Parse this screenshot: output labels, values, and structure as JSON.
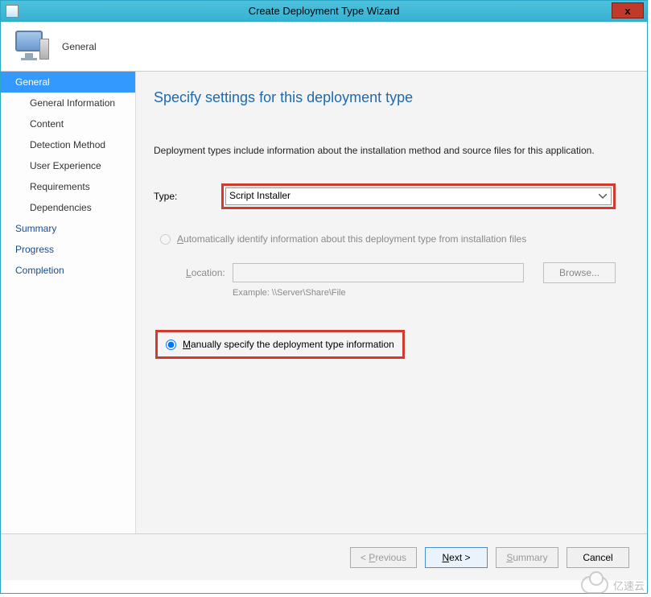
{
  "window": {
    "title": "Create Deployment Type Wizard",
    "close": "x"
  },
  "header": {
    "section": "General"
  },
  "sidebar": {
    "items": [
      {
        "label": "General",
        "active": true,
        "sub": false
      },
      {
        "label": "General Information",
        "active": false,
        "sub": true
      },
      {
        "label": "Content",
        "active": false,
        "sub": true
      },
      {
        "label": "Detection Method",
        "active": false,
        "sub": true
      },
      {
        "label": "User Experience",
        "active": false,
        "sub": true
      },
      {
        "label": "Requirements",
        "active": false,
        "sub": true
      },
      {
        "label": "Dependencies",
        "active": false,
        "sub": true
      },
      {
        "label": "Summary",
        "active": false,
        "sub": false
      },
      {
        "label": "Progress",
        "active": false,
        "sub": false
      },
      {
        "label": "Completion",
        "active": false,
        "sub": false
      }
    ]
  },
  "content": {
    "heading": "Specify settings for this deployment type",
    "description": "Deployment types include information about the installation method and source files for this application.",
    "type_label": "Type:",
    "type_value": "Script Installer",
    "auto_radio": {
      "prefix": "A",
      "rest": "utomatically identify information about this deployment type from installation files"
    },
    "location_label": "Location:",
    "browse_label": "Browse...",
    "example_text": "Example: \\\\Server\\Share\\File",
    "manual_radio": {
      "prefix": "M",
      "rest": "anually specify the deployment type information"
    }
  },
  "footer": {
    "previous": "< Previous",
    "next": "Next >",
    "summary": "Summary",
    "cancel": "Cancel"
  },
  "watermark": {
    "text": "亿速云"
  }
}
